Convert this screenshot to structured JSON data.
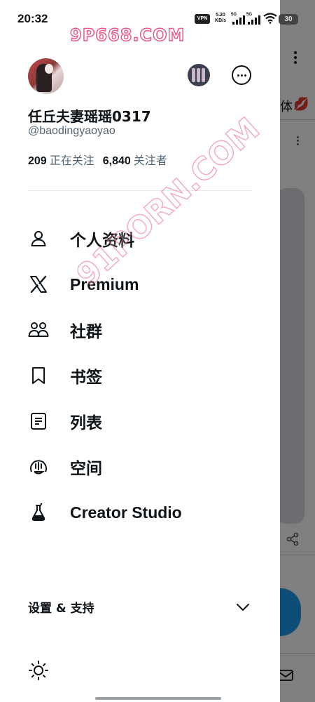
{
  "status_bar": {
    "time": "20:32",
    "vpn": "VPN",
    "speed_value": "5.20",
    "speed_unit": "KB/s",
    "signal1": "5G",
    "signal2": "5G",
    "battery": "30"
  },
  "watermarks": {
    "top": "9P668.COM",
    "diagonal": "91PORN.COM"
  },
  "profile": {
    "display_name": "任丘夫妻瑶瑶0317",
    "handle": "@baodingyaoyao",
    "following_count": "209",
    "following_label": "正在关注",
    "followers_count": "6,840",
    "followers_label": "关注者"
  },
  "menu": [
    {
      "label": "个人资料",
      "icon": "person-icon"
    },
    {
      "label": "Premium",
      "icon": "x-logo-icon"
    },
    {
      "label": "社群",
      "icon": "communities-icon"
    },
    {
      "label": "书签",
      "icon": "bookmark-icon"
    },
    {
      "label": "列表",
      "icon": "list-icon"
    },
    {
      "label": "空间",
      "icon": "spaces-icon"
    },
    {
      "label": "Creator Studio",
      "icon": "flask-icon"
    }
  ],
  "settings": {
    "label": "设置 & 支持"
  },
  "background": {
    "partial_text": "体"
  },
  "colors": {
    "primary_text": "#0f1419",
    "secondary_text": "#536471",
    "accent": "#1d9bf0"
  }
}
